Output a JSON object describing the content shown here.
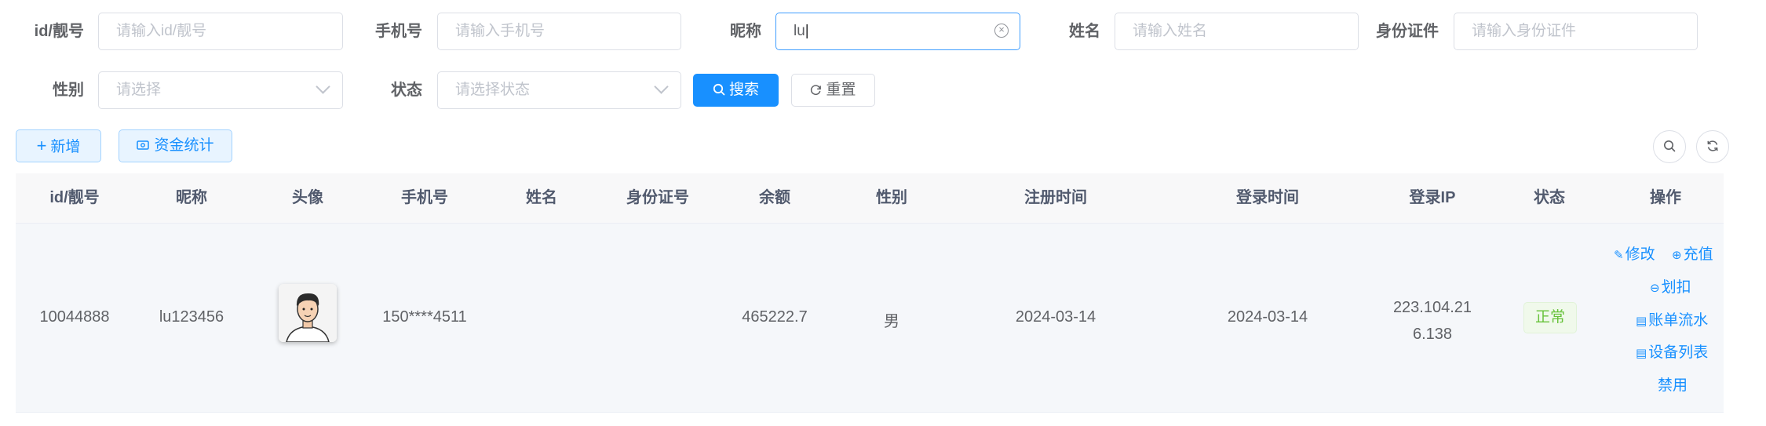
{
  "filters": {
    "id": {
      "label": "id/靓号",
      "placeholder": "请输入id/靓号"
    },
    "phone": {
      "label": "手机号",
      "placeholder": "请输入手机号"
    },
    "nickname": {
      "label": "昵称",
      "value": "lu"
    },
    "name": {
      "label": "姓名",
      "placeholder": "请输入姓名"
    },
    "idcard": {
      "label": "身份证件",
      "placeholder": "请输入身份证件"
    },
    "gender": {
      "label": "性别",
      "placeholder": "请选择"
    },
    "status": {
      "label": "状态",
      "placeholder": "请选择状态"
    }
  },
  "buttons": {
    "search": "搜索",
    "reset": "重置",
    "add": "新增",
    "fund_stats": "资金统计"
  },
  "icons": {
    "search": "search-icon",
    "refresh": "refresh-icon",
    "plus": "plus-icon",
    "money": "money-icon",
    "clear": "circle-close-icon",
    "chevron": "chevron-down-icon"
  },
  "table": {
    "columns": [
      "id/靓号",
      "昵称",
      "头像",
      "手机号",
      "姓名",
      "身份证号",
      "余额",
      "性别",
      "注册时间",
      "登录时间",
      "登录IP",
      "状态",
      "操作"
    ],
    "rows": [
      {
        "id": "10044888",
        "nickname": "lu123456",
        "phone": "150****4511",
        "name": "",
        "idcard": "",
        "balance": "465222.7",
        "gender": "男",
        "register_time": "2024-03-14",
        "login_time": "2024-03-14",
        "login_ip_line1": "223.104.21",
        "login_ip_line2": "6.138",
        "status": "正常",
        "actions": {
          "edit": "修改",
          "recharge": "充值",
          "deduct": "划扣",
          "bill_flow": "账单流水",
          "device_list": "设备列表",
          "disable": "禁用"
        }
      }
    ]
  },
  "colors": {
    "primary": "#1890ff",
    "success": "#67c23a",
    "header_bg": "#f8f8f9",
    "row_bg": "#f5f7fa"
  }
}
